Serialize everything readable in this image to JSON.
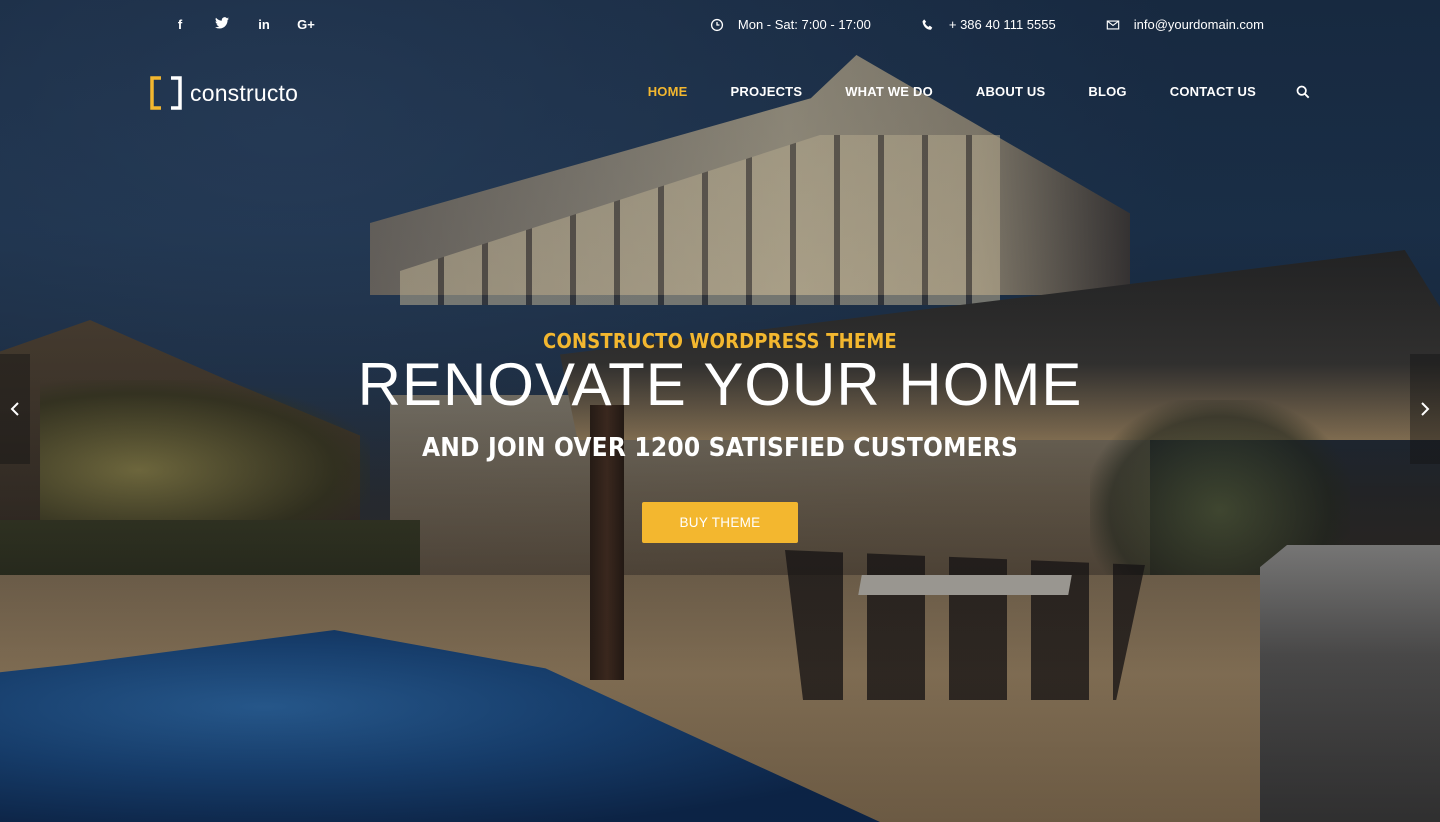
{
  "topbar": {
    "social": [
      {
        "label": "f",
        "icon": "facebook-icon"
      },
      {
        "label": "t",
        "icon": "twitter-icon"
      },
      {
        "label": "in",
        "icon": "linkedin-icon"
      },
      {
        "label": "G+",
        "icon": "google-plus-icon"
      }
    ],
    "hours": "Mon - Sat: 7:00 - 17:00",
    "phone": "+ 386 40 111 5555",
    "email": "info@yourdomain.com"
  },
  "brand": {
    "name": "constructo",
    "accent_color": "#f3b72f"
  },
  "nav": {
    "items": [
      "HOME",
      "PROJECTS",
      "WHAT WE DO",
      "ABOUT US",
      "BLOG",
      "CONTACT US"
    ],
    "active": "HOME"
  },
  "hero": {
    "eyebrow": "CONSTRUCTO WORDPRESS THEME",
    "headline": "RENOVATE YOUR HOME",
    "subline": "AND JOIN OVER 1200 SATISFIED CUSTOMERS",
    "cta_label": "BUY THEME"
  }
}
